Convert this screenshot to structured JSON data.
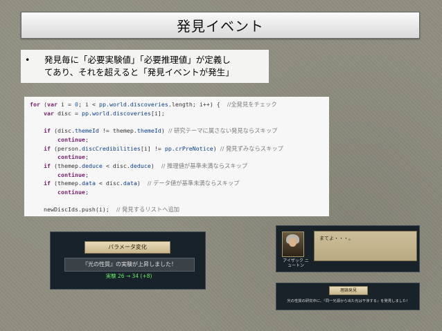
{
  "slide": {
    "title": "発見イベント",
    "bullet_symbol": "•",
    "bullet_line1": "発見毎に「必要実験値」「必要推理値」が定義し",
    "bullet_line2": "てあり、それを超えると「発見イベントが発生」"
  },
  "code": {
    "l1_kw": "for",
    "l1_a": " (",
    "l1_var": "var",
    "l1_b": " i = ",
    "l1_zero": "0",
    "l1_c": "; i < ",
    "l1_id": "pp.world.discoveries",
    "l1_d": ".length; i++) {  ",
    "l1_cm": "//全発見をチェック",
    "l2_var": "var",
    "l2_a": " disc = ",
    "l2_id": "pp.world.discoveries",
    "l2_b": "[i];",
    "l3_if": "if",
    "l3_a": " (disc.",
    "l3_id1": "themeId",
    "l3_b": " != themep.",
    "l3_id2": "themeId",
    "l3_c": ") ",
    "l3_cm": "// 研究テーマに属さない発見ならスキップ",
    "l4_kw": "continue",
    "l4_a": ";",
    "l5_if": "if",
    "l5_a": " (person.",
    "l5_id1": "discCredibilities",
    "l5_b": "[i] != ",
    "l5_id2": "pp.crPreNotice",
    "l5_c": ") ",
    "l5_cm": "// 発見ずみならスキップ",
    "l6_kw": "continue",
    "l6_a": ";",
    "l7_if": "if",
    "l7_a": " (themep.",
    "l7_id1": "deduce",
    "l7_b": " < disc.",
    "l7_id2": "deduce",
    "l7_c": ")  ",
    "l7_cm": "// 推理値が基準未満ならスキップ",
    "l8_kw": "continue",
    "l8_a": ";",
    "l9_if": "if",
    "l9_a": " (themep.",
    "l9_id1": "data",
    "l9_b": " < disc.",
    "l9_id2": "data",
    "l9_c": ")  ",
    "l9_cm": "// データ値が基準未満ならスキップ",
    "l10_kw": "continue",
    "l10_a": ";",
    "l11_a": "newDiscIds.push(i);  ",
    "l11_cm": "// 発見するリストへ追加",
    "l12": "}"
  },
  "game1": {
    "header": "パラメータ変化",
    "message": "『光の性質』の実験が上昇しました！",
    "value": "実験  26  →  34  (+8)"
  },
  "game2": {
    "speech": "まてよ・・・。",
    "name": "アイザック ニュートン"
  },
  "game3": {
    "tag": "理論発見",
    "text": "光の性質の研究中に、『同一光源から出た光は干渉する』を発見しました！"
  },
  "colors": {
    "background": "#8f8e80",
    "keyword": "#7a1f6e",
    "identifier": "#0a3d91",
    "comment": "#7c7c7c",
    "value_green": "#66ee66"
  }
}
